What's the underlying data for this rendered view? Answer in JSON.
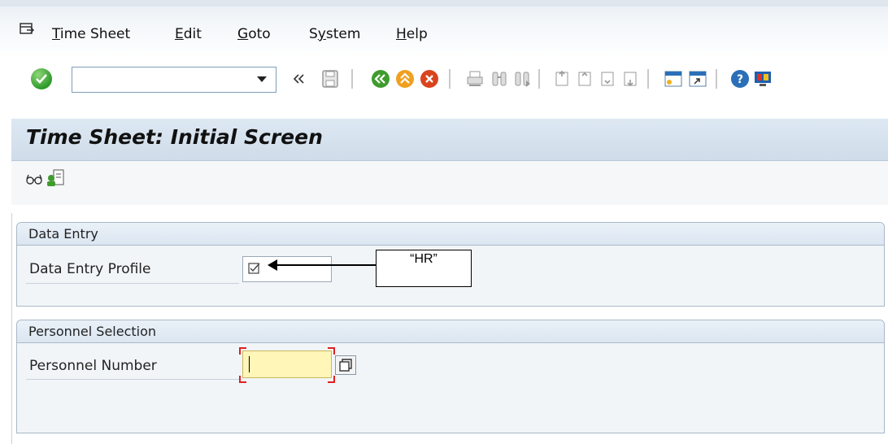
{
  "menu": {
    "items": [
      {
        "accel": "T",
        "rest": "ime Sheet"
      },
      {
        "accel": "E",
        "rest": "dit"
      },
      {
        "accel": "G",
        "rest": "oto"
      },
      {
        "accel": "",
        "pre": "S",
        "mid": "y",
        "rest": "stem"
      },
      {
        "accel": "H",
        "rest": "elp"
      }
    ],
    "time_sheet": "Time Sheet",
    "edit": "Edit",
    "goto": "Goto",
    "system": "System",
    "help": "Help"
  },
  "toolbar": {
    "command_value": "",
    "icons": [
      "enter-icon",
      "back-double-arrow-icon",
      "save-icon",
      "back-icon",
      "exit-icon",
      "cancel-icon",
      "print-icon",
      "find-icon",
      "find-next-icon",
      "first-page-icon",
      "previous-page-icon",
      "next-page-icon",
      "last-page-icon",
      "create-session-icon",
      "shortcut-icon",
      "help-icon",
      "customize-layout-icon"
    ],
    "colors": {
      "green": "#2e9a2a",
      "orange": "#f0a020",
      "red": "#d9441e",
      "blue": "#2a6fb7"
    }
  },
  "title": "Time Sheet: Initial Screen",
  "app_toolbar": {
    "icons": [
      "glasses-icon",
      "org-assignment-icon"
    ]
  },
  "data_entry": {
    "heading": "Data Entry",
    "profile_label": "Data Entry Profile"
  },
  "personnel": {
    "heading": "Personnel Selection",
    "number_label": "Personnel Number",
    "number_value": ""
  },
  "annotation": {
    "text": "“HR”"
  }
}
